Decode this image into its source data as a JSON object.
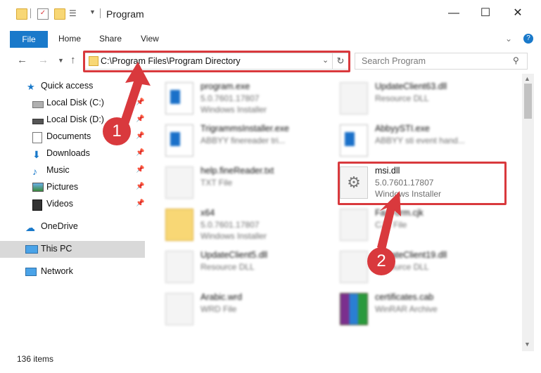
{
  "window": {
    "title": "Program",
    "minimize": "—",
    "maximize": "☐",
    "close": "✕"
  },
  "ribbon": {
    "tabs": [
      "File",
      "Home",
      "Share",
      "View"
    ],
    "help": "?"
  },
  "address": {
    "path": "C:\\Program Files\\Program Directory",
    "search_placeholder": "Search Program"
  },
  "sidebar": {
    "quick_access": "Quick access",
    "items": [
      {
        "label": "Local Disk (C:)",
        "icon": "drive-icon",
        "pinned": true
      },
      {
        "label": "Local Disk (D:)",
        "icon": "drive-icon",
        "pinned": true
      },
      {
        "label": "Documents",
        "icon": "documents-icon",
        "pinned": true
      },
      {
        "label": "Downloads",
        "icon": "downloads-icon",
        "pinned": true
      },
      {
        "label": "Music",
        "icon": "music-icon",
        "pinned": true
      },
      {
        "label": "Pictures",
        "icon": "pictures-icon",
        "pinned": true
      },
      {
        "label": "Videos",
        "icon": "videos-icon",
        "pinned": true
      }
    ],
    "onedrive": "OneDrive",
    "this_pc": "This PC",
    "network": "Network"
  },
  "files": [
    {
      "name": "program.exe",
      "line1": "5.0.7601.17807",
      "line2": "Windows Installer",
      "icon": "installer-icon"
    },
    {
      "name": "UpdateClient63.dll",
      "line1": "Resource DLL",
      "line2": "",
      "icon": "dll-icon"
    },
    {
      "name": "TrigrammsInstaller.exe",
      "line1": "ABBYY finereader tri...",
      "line2": "",
      "icon": "exe-icon"
    },
    {
      "name": "AbbyySTI.exe",
      "line1": "ABBYY sti event hand...",
      "line2": "",
      "icon": "exe-icon"
    },
    {
      "name": "help.fineReader.txt",
      "line1": "TXT File",
      "line2": "",
      "icon": "txt-icon"
    },
    {
      "name": "msi.dll",
      "line1": "5.0.7601.17807",
      "line2": "Windows Installer",
      "icon": "gear-dll-icon"
    },
    {
      "name": "x64",
      "line1": "5.0.7601.17807",
      "line2": "Windows Installer",
      "icon": "folder-icon"
    },
    {
      "name": "FaxForm.cjk",
      "line1": "CJK File",
      "line2": "",
      "icon": "file-icon"
    },
    {
      "name": "UpdateClient5.dll",
      "line1": "Resource DLL",
      "line2": "",
      "icon": "dll-icon"
    },
    {
      "name": "UpdateClient19.dll",
      "line1": "Resource DLL",
      "line2": "",
      "icon": "dll-icon"
    },
    {
      "name": "Arabic.wrd",
      "line1": "WRD File",
      "line2": "",
      "icon": "file-icon"
    },
    {
      "name": "certificates.cab",
      "line1": "WinRAR Archive",
      "line2": "",
      "icon": "winrar-icon"
    }
  ],
  "status": {
    "count": "136 items"
  },
  "callouts": [
    "1",
    "2"
  ],
  "colors": {
    "accent": "#1979ca",
    "highlight": "#d9393d"
  }
}
